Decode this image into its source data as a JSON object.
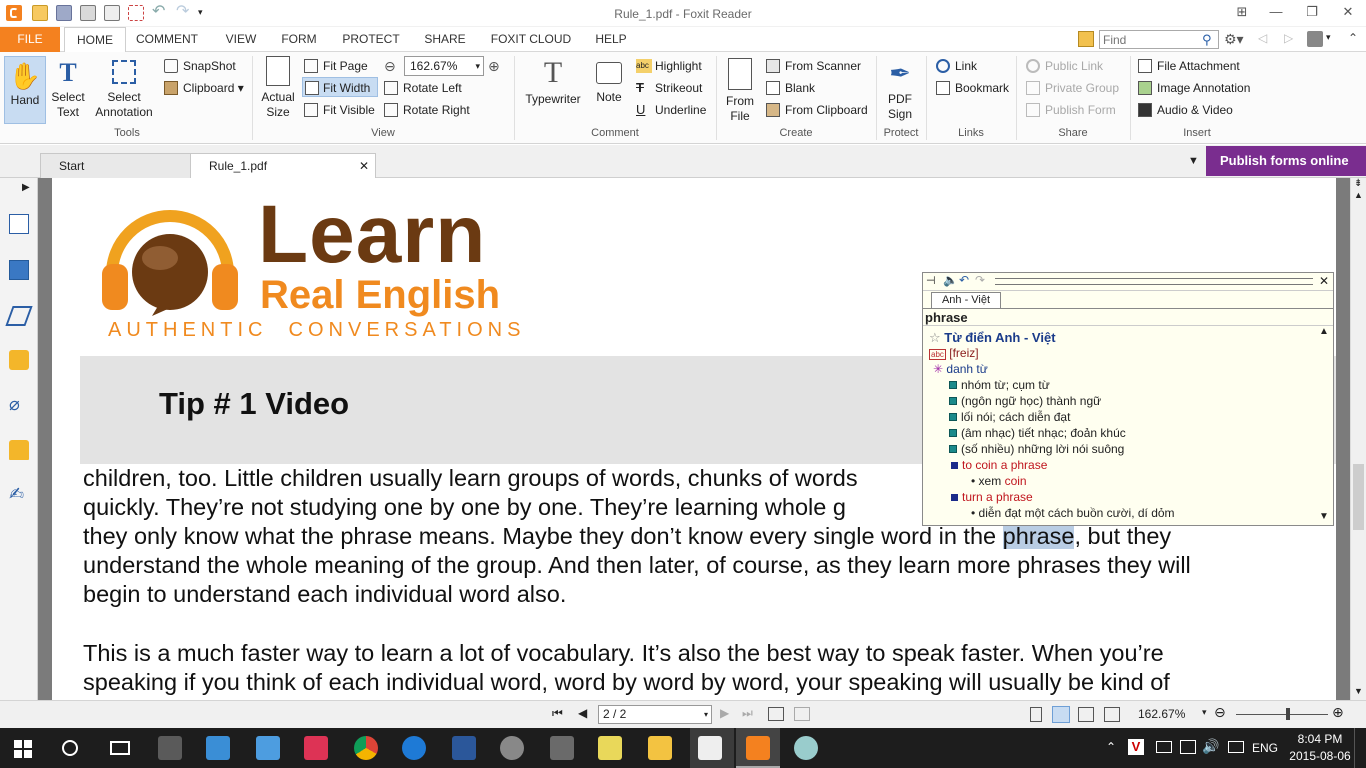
{
  "window": {
    "title": "Rule_1.pdf - Foxit Reader"
  },
  "menu": {
    "tabs": [
      "FILE",
      "HOME",
      "COMMENT",
      "VIEW",
      "FORM",
      "PROTECT",
      "SHARE",
      "FOXIT CLOUD",
      "HELP"
    ],
    "find_placeholder": "Find"
  },
  "ribbon": {
    "tools": {
      "hand": "Hand",
      "select_text": "Select Text",
      "select_annotation": "Select Annotation",
      "snapshot": "SnapShot",
      "clipboard": "Clipboard",
      "group": "Tools"
    },
    "view": {
      "actual_size": "Actual Size",
      "fit_page": "Fit Page",
      "fit_width": "Fit Width",
      "fit_visible": "Fit Visible",
      "zoom": "162.67%",
      "rotate_left": "Rotate Left",
      "rotate_right": "Rotate Right",
      "group": "View"
    },
    "comment": {
      "typewriter": "Typewriter",
      "note": "Note",
      "highlight": "Highlight",
      "strikeout": "Strikeout",
      "underline": "Underline",
      "group": "Comment"
    },
    "create": {
      "from_file": "From File",
      "from_scanner": "From Scanner",
      "blank": "Blank",
      "from_clipboard": "From Clipboard",
      "group": "Create"
    },
    "protect": {
      "pdf_sign": "PDF Sign",
      "group": "Protect"
    },
    "links": {
      "link": "Link",
      "bookmark": "Bookmark",
      "group": "Links"
    },
    "share": {
      "public_link": "Public Link",
      "private_group": "Private Group",
      "publish_form": "Publish Form",
      "group": "Share"
    },
    "insert": {
      "file_attachment": "File Attachment",
      "image_annotation": "Image Annotation",
      "audio_video": "Audio & Video",
      "group": "Insert"
    }
  },
  "doc_tabs": {
    "start": "Start",
    "rule": "Rule_1.pdf",
    "publish": "Publish forms online"
  },
  "document": {
    "logo": {
      "learn": "Learn",
      "real_english": "Real English",
      "tagline": "AUTHENTIC  CONVERSATIONS"
    },
    "banner": "Tip # 1 Video",
    "lines": [
      "children, too.  Little children usually learn groups of words, chunks of words",
      "quickly.  They’re not studying one by one by one.  They’re learning whole g",
      "they only know what the phrase means.  Maybe they don’t know every single word in the ",
      "understand the whole meaning of the group.  And then later, of course, as they learn more phrases they will",
      "begin to understand each individual word also.",
      "This is a much faster way to learn a lot of vocabulary.  It’s also the best way to speak faster.  When you’re",
      "speaking if you think of each individual word, word by word by word, your speaking will usually be kind of"
    ],
    "highlight_word": "phrase",
    "line3_tail": ", but they"
  },
  "dictionary": {
    "tab": "Anh - Việt",
    "word": "phrase",
    "source": "Từ điển Anh - Việt",
    "pron": "[freiz]",
    "pos": "danh từ",
    "senses": [
      "nhóm từ; cụm từ",
      "(ngôn ngữ học) thành ngữ",
      "lối nói; cách diễn đạt",
      "(âm nhạc) tiết nhạc; đoản khúc",
      "(số nhiều) những lời nói suông"
    ],
    "idiom1": "to coin a phrase",
    "idiom1_xem": "xem ",
    "idiom1_link": "coin",
    "idiom2": "turn a phrase",
    "idiom2_def": "diễn đạt một cách buồn cười, dí dỏm"
  },
  "status": {
    "page": "2 / 2",
    "zoom": "162.67%"
  },
  "taskbar": {
    "time": "8:04 PM",
    "date": "2015-08-06",
    "lang": "ENG"
  },
  "colors": {
    "accent": "#f4811f",
    "brown": "#6b3a12",
    "orange": "#f08a1f",
    "purple": "#7a2d8f"
  }
}
